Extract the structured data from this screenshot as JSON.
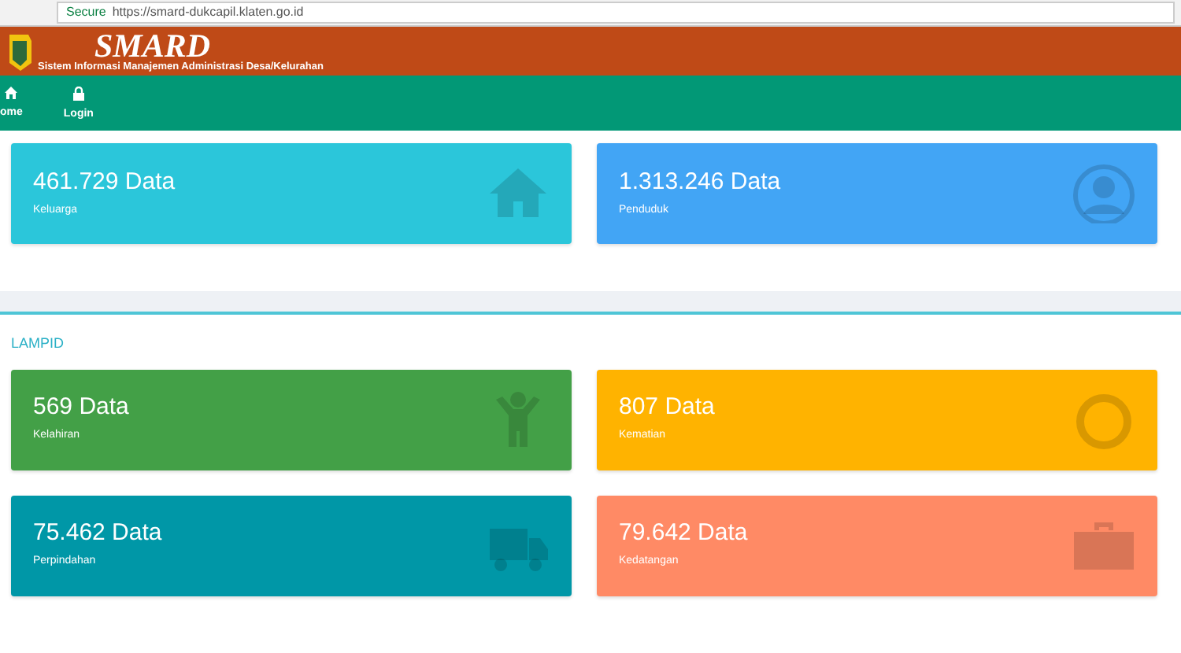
{
  "browser": {
    "secure_label": "Secure",
    "url": "https://smard-dukcapil.klaten.go.id"
  },
  "header": {
    "title": "SMARD",
    "subtitle": "Sistem Informasi Manajemen Administrasi Desa/Kelurahan"
  },
  "nav": [
    {
      "label": "ome",
      "kind": "home"
    },
    {
      "label": "Login",
      "kind": "lock"
    }
  ],
  "summary": [
    {
      "value": "461.729 Data",
      "label": "Keluarga",
      "color": "#2bc6da",
      "kind": "house"
    },
    {
      "value": "1.313.246 Data",
      "label": "Penduduk",
      "color": "#42a5f5",
      "kind": "user"
    }
  ],
  "lampid": {
    "title": "LAMPID",
    "cards": [
      {
        "value": "569 Data",
        "label": "Kelahiran",
        "color": "#43a047",
        "kind": "child"
      },
      {
        "value": "807 Data",
        "label": "Kematian",
        "color": "#ffb300",
        "kind": "ring"
      },
      {
        "value": "75.462 Data",
        "label": "Perpindahan",
        "color": "#0097a7",
        "kind": "truck"
      },
      {
        "value": "79.642 Data",
        "label": "Kedatangan",
        "color": "#ff8a65",
        "kind": "briefcase"
      }
    ]
  }
}
